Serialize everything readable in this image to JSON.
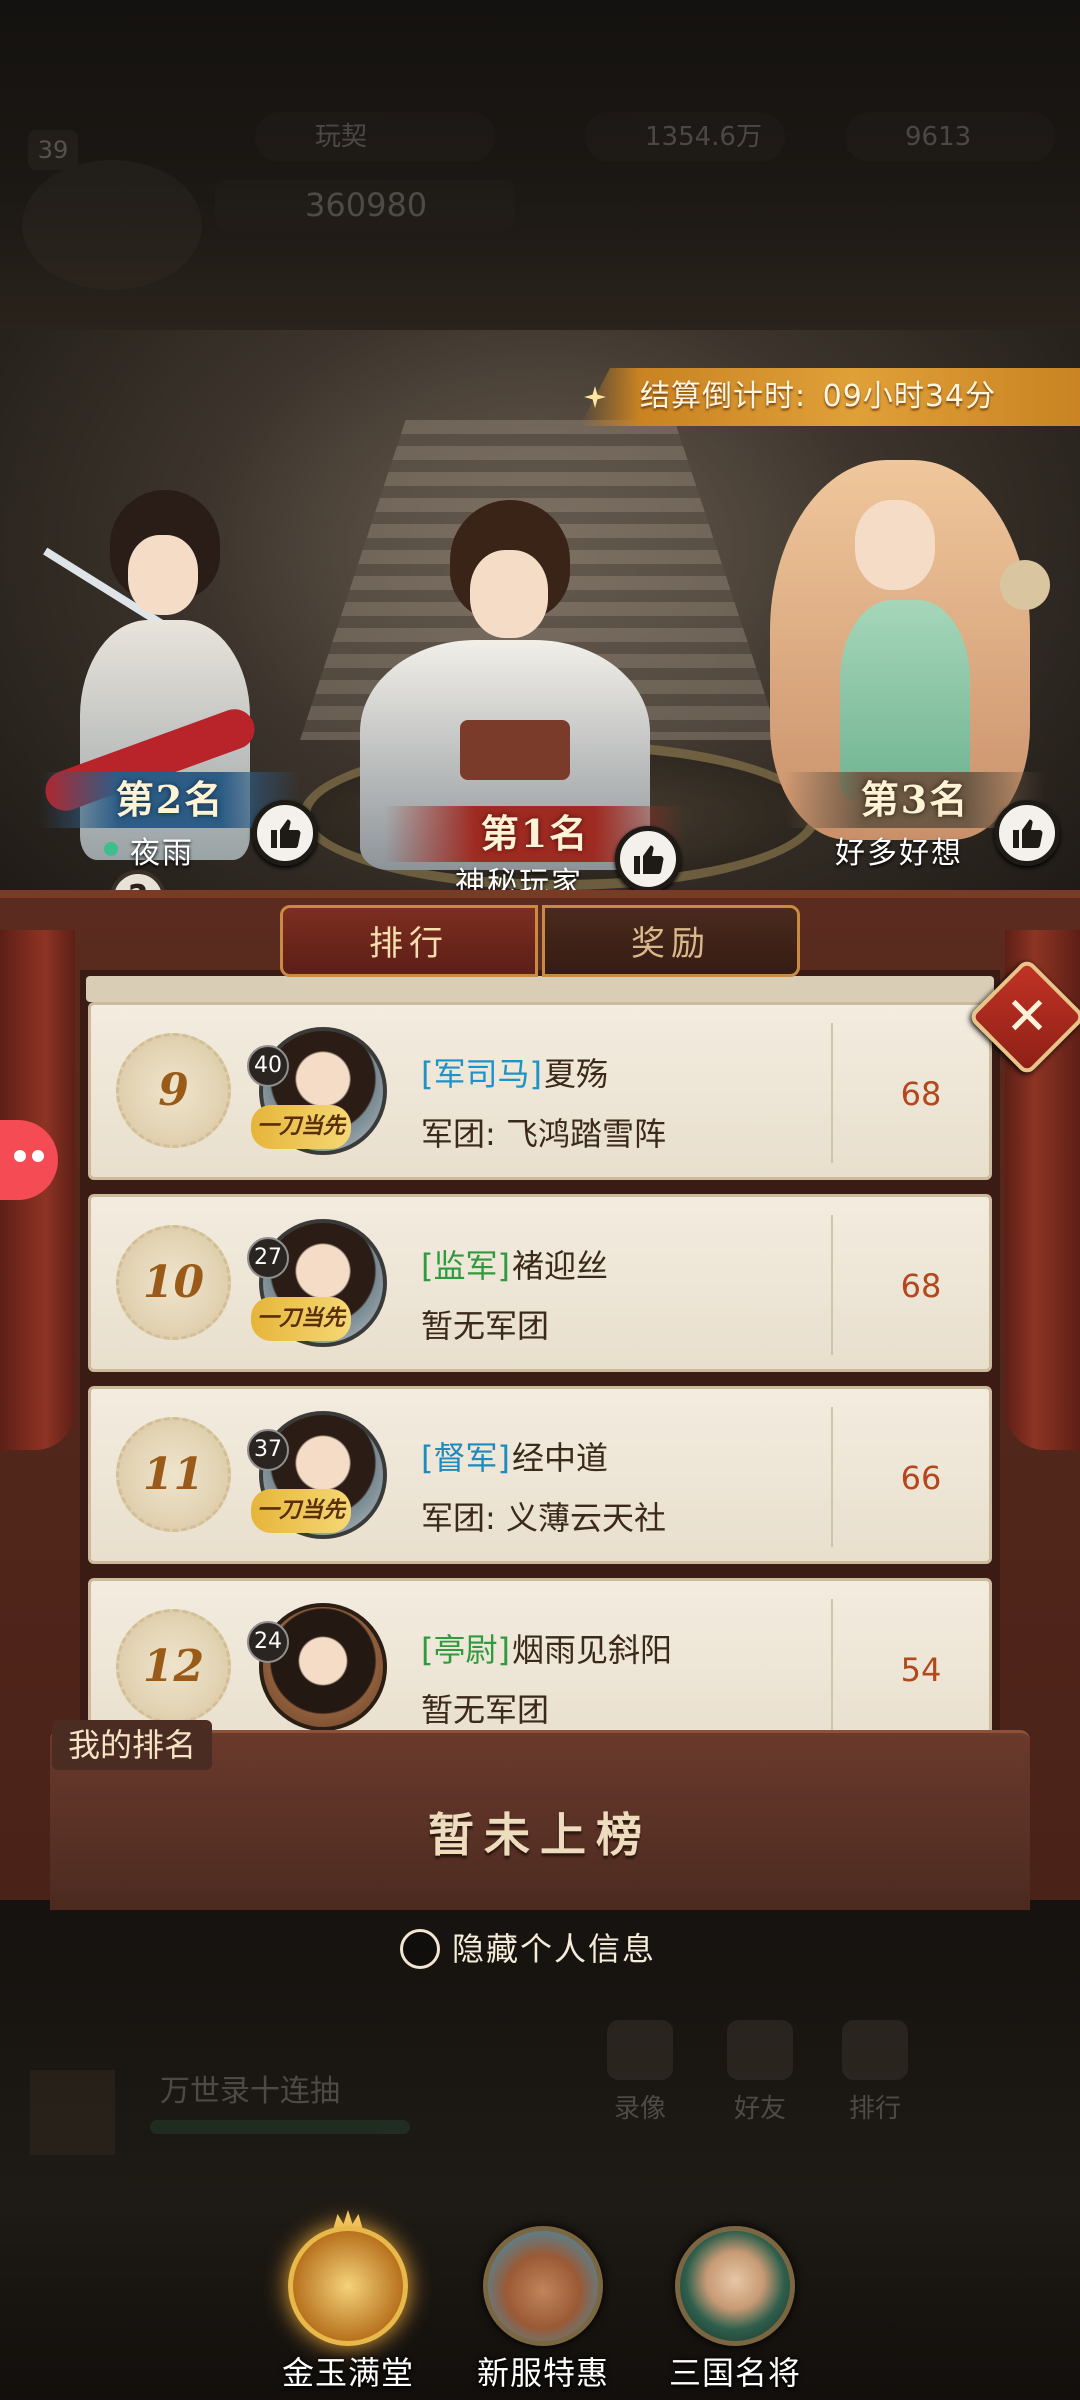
{
  "hud": {
    "level": "39",
    "vip_label": "玩契",
    "gold": "1354.6万",
    "gems": "9613",
    "power": "360980"
  },
  "countdown": {
    "label": "结算倒计时:",
    "value": "09小时34分"
  },
  "podium": [
    {
      "rank_label": "第2名",
      "name": "夜雨"
    },
    {
      "rank_label": "第1名",
      "name": "神秘玩家"
    },
    {
      "rank_label": "第3名",
      "name": "好多好想"
    }
  ],
  "tabs": [
    {
      "label": "排行",
      "active": true
    },
    {
      "label": "奖励",
      "active": false
    }
  ],
  "ranking_rows": [
    {
      "rank": "9",
      "level": "40",
      "badge": "一刀当先",
      "title": "军司马",
      "title_color": "#1d93c8",
      "name": "夏殇",
      "guild": "军团: 飞鸿踏雪阵",
      "score": "68"
    },
    {
      "rank": "10",
      "level": "27",
      "badge": "一刀当先",
      "title": "监军",
      "title_color": "#2f9b3e",
      "name": "褚迎丝",
      "guild": "暂无军团",
      "score": "68"
    },
    {
      "rank": "11",
      "level": "37",
      "badge": "一刀当先",
      "title": "督军",
      "title_color": "#1d8bbf",
      "name": "经中道",
      "guild": "军团: 义薄云天社",
      "score": "66"
    },
    {
      "rank": "12",
      "level": "24",
      "badge": "",
      "title": "亭尉",
      "title_color": "#2f9b3e",
      "name": "烟雨见斜阳",
      "guild": "暂无军团",
      "score": "54"
    }
  ],
  "my_rank": {
    "label": "我的排名",
    "value": "暂未上榜"
  },
  "hide_info": {
    "label": "隐藏个人信息",
    "checked": false
  },
  "lower_app": {
    "event_title": "万世录十连抽",
    "nav": [
      "录像",
      "好友",
      "排行"
    ]
  },
  "bottom_buttons": [
    {
      "label": "金玉满堂"
    },
    {
      "label": "新服特惠"
    },
    {
      "label": "三国名将"
    }
  ],
  "colors": {
    "panel_red": "#5a2b1e",
    "tab_gold": "#c98b43",
    "score_orange": "#b5471c",
    "rank_brown": "#9a5a18",
    "countdown_orange": "#e0a038"
  }
}
